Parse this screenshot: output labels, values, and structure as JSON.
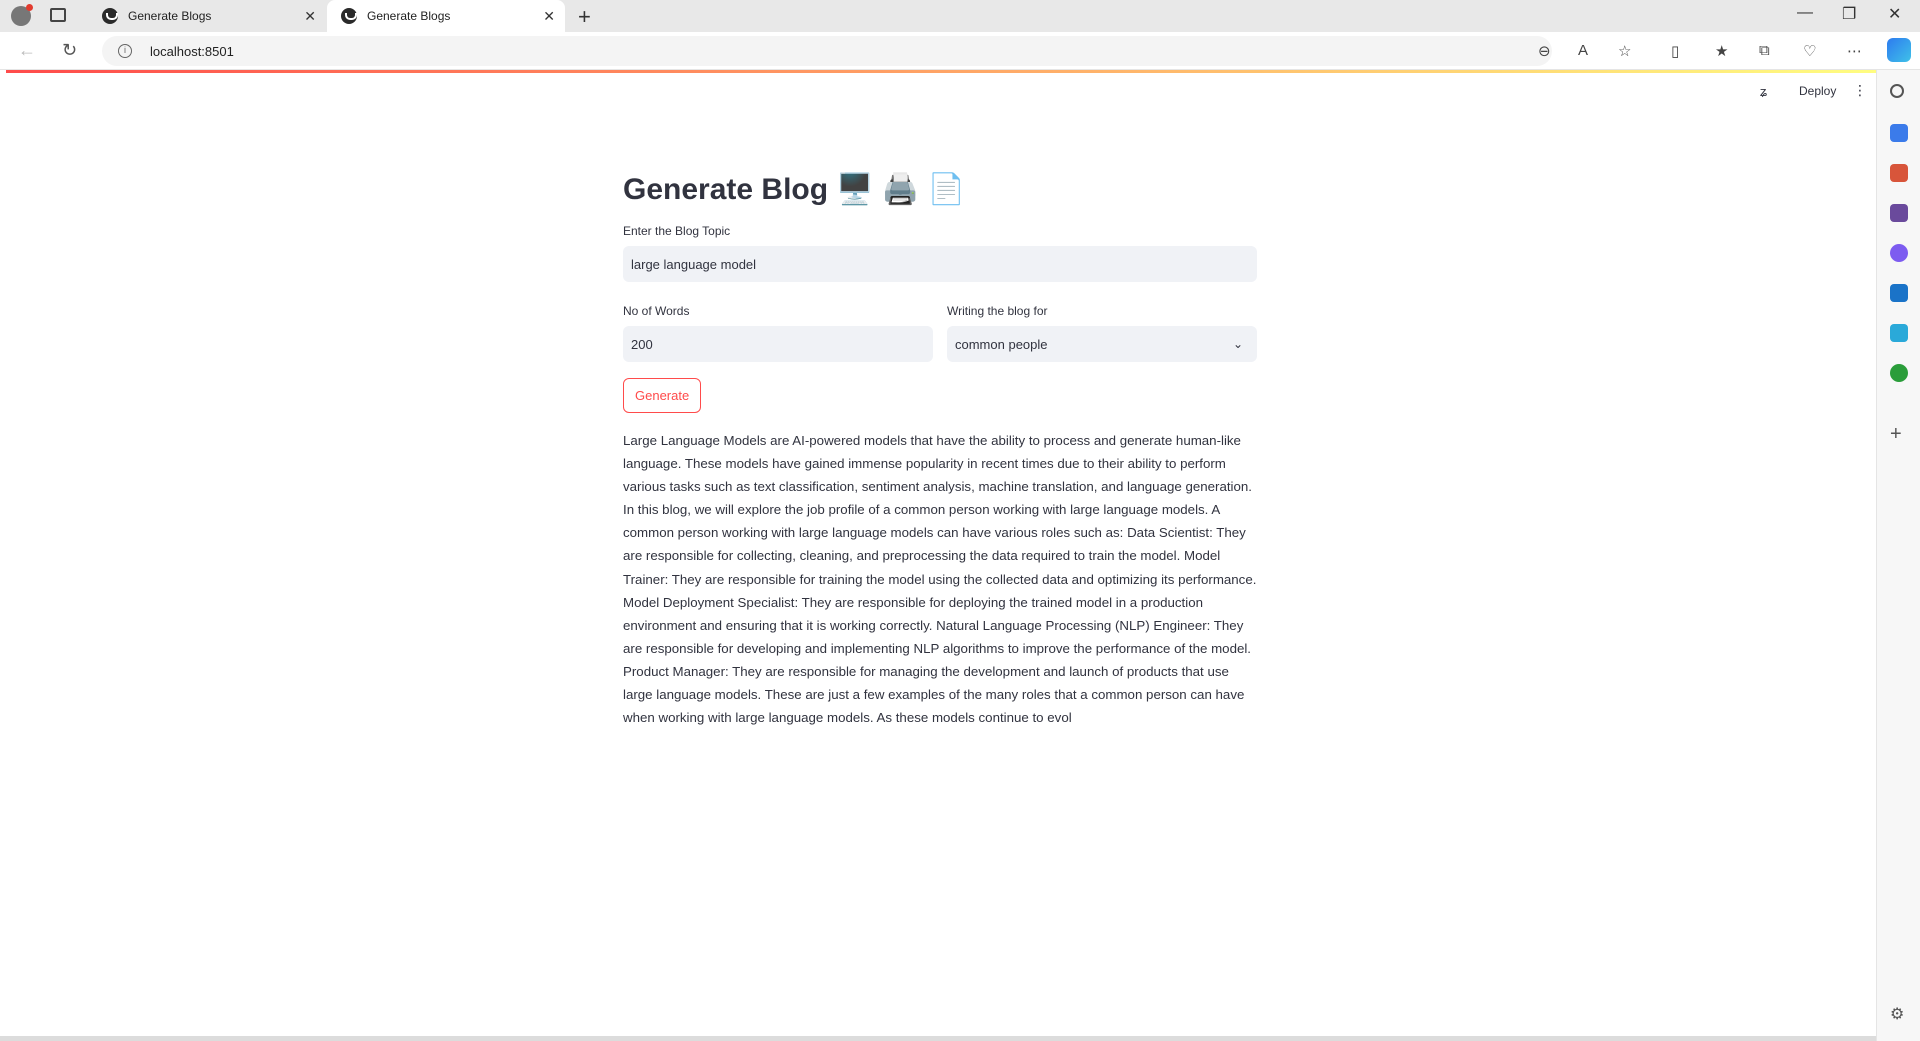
{
  "browser": {
    "tabs": [
      {
        "title": "Generate Blogs",
        "active": false
      },
      {
        "title": "Generate Blogs",
        "active": true
      }
    ],
    "url": "localhost:8501"
  },
  "app_header": {
    "deploy_label": "Deploy"
  },
  "app": {
    "title": "Generate Blog",
    "title_emoji": "🖥️ 🖨️ 📄",
    "topic_label": "Enter the Blog Topic",
    "topic_value": "large language model",
    "words_label": "No of Words",
    "words_value": "200",
    "audience_label": "Writing the blog for",
    "audience_value": "common people",
    "generate_label": "Generate",
    "output": "Large Language Models are AI-powered models that have the ability to process and generate human-like language. These models have gained immense popularity in recent times due to their ability to perform various tasks such as text classification, sentiment analysis, machine translation, and language generation. In this blog, we will explore the job profile of a common person working with large language models. A common person working with large language models can have various roles such as: Data Scientist: They are responsible for collecting, cleaning, and preprocessing the data required to train the model. Model Trainer: They are responsible for training the model using the collected data and optimizing its performance. Model Deployment Specialist: They are responsible for deploying the trained model in a production environment and ensuring that it is working correctly. Natural Language Processing (NLP) Engineer: They are responsible for developing and implementing NLP algorithms to improve the performance of the model. Product Manager: They are responsible for managing the development and launch of products that use large language models. These are just a few examples of the many roles that a common person can have when working with large language models. As these models continue to evol"
  },
  "colors": {
    "accent": "#ff4b4b",
    "text": "#31333f",
    "input_bg": "#f0f2f6"
  }
}
